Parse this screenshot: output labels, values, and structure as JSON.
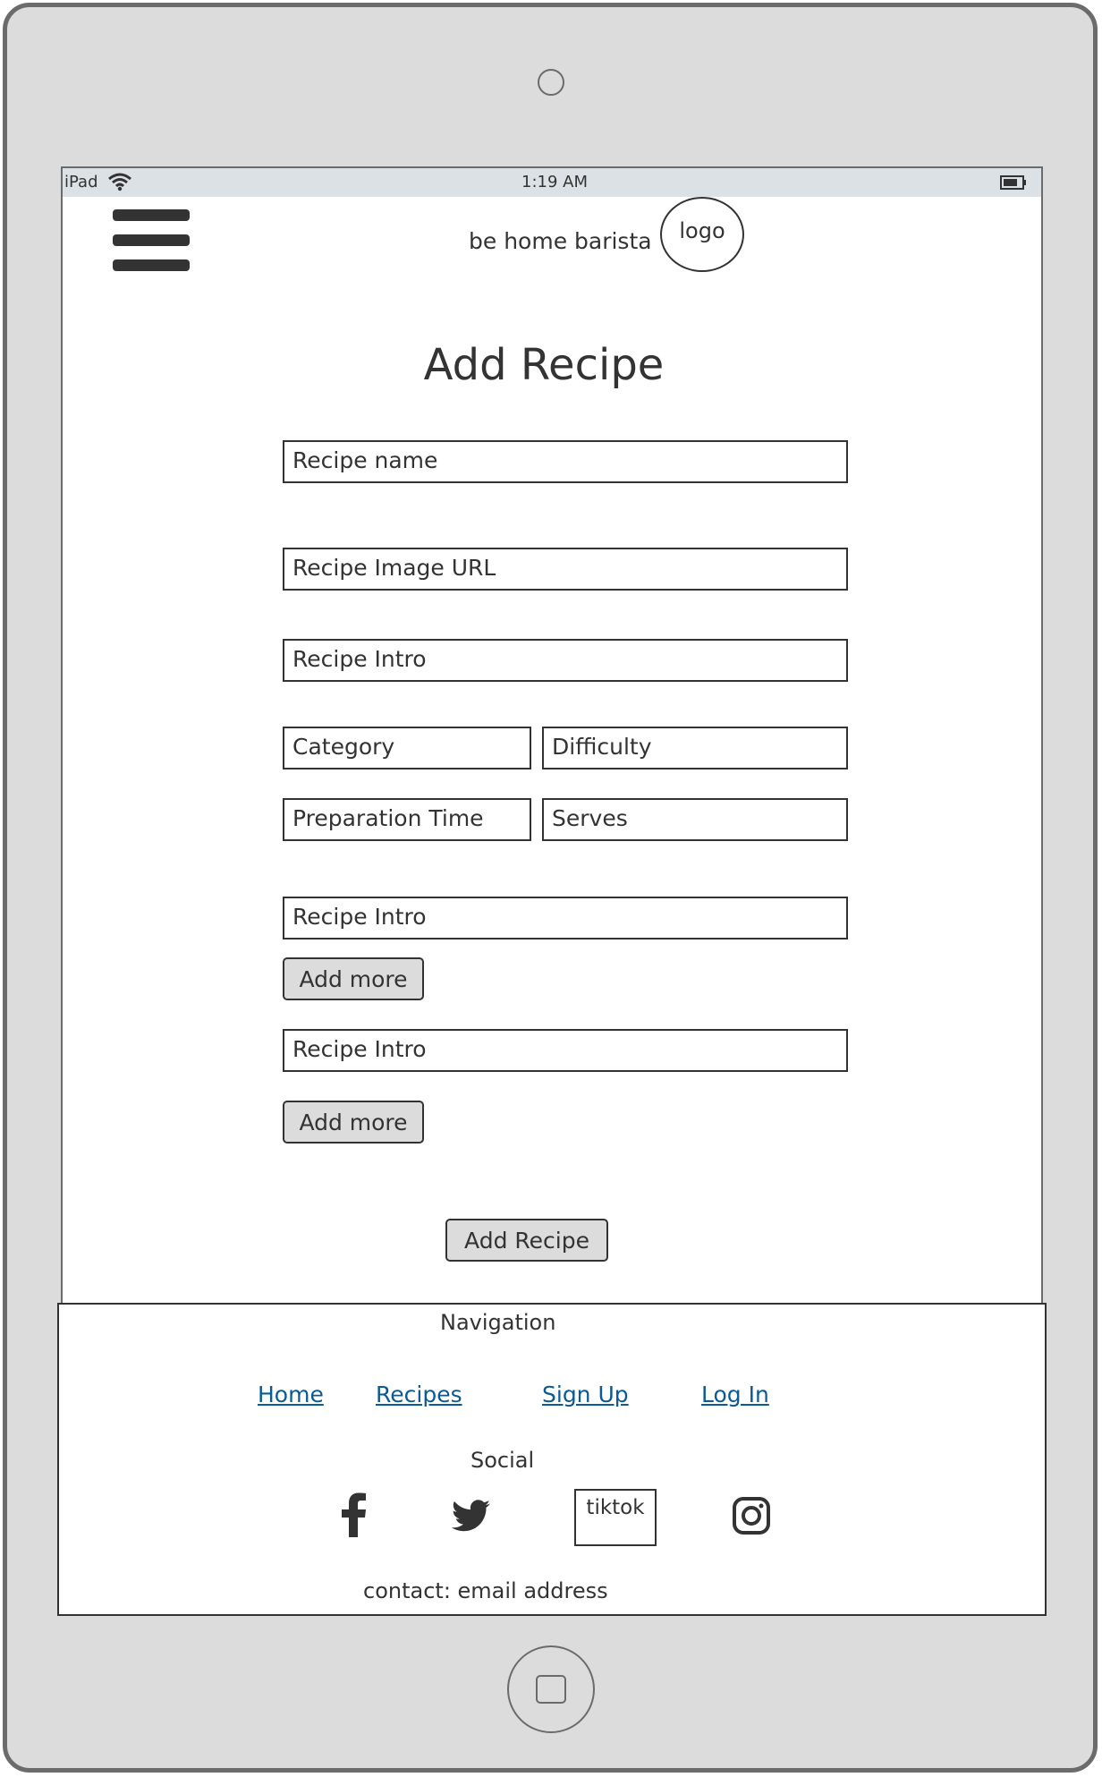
{
  "status_bar": {
    "carrier": "iPad",
    "time": "1:19 AM"
  },
  "header": {
    "brand": "be home barista",
    "logo_label": "logo"
  },
  "page": {
    "title": "Add Recipe"
  },
  "form": {
    "recipe_name": "Recipe name",
    "image_url": "Recipe Image URL",
    "intro": "Recipe Intro",
    "category": "Category",
    "difficulty": "Difficulty",
    "prep_time": "Preparation Time",
    "serves": "Serves",
    "list_one_field": "Recipe Intro",
    "add_more_one": "Add more",
    "list_two_field": "Recipe Intro",
    "add_more_two": "Add more",
    "submit": "Add Recipe"
  },
  "footer": {
    "navigation_heading": "Navigation",
    "links": [
      "Home",
      "Recipes",
      "Sign Up",
      "Log In"
    ],
    "social_heading": "Social",
    "social": {
      "facebook": "facebook-icon",
      "twitter": "twitter-icon",
      "tiktok": "tiktok",
      "instagram": "instagram-icon"
    },
    "contact": "contact: email address"
  },
  "colors": {
    "frame": "#dcdcdc",
    "frame_border": "#6b6b6b",
    "status_bar": "#dbe1e5",
    "text": "#333333",
    "link": "#0b5a94",
    "button_bg": "#dcdcdc"
  }
}
